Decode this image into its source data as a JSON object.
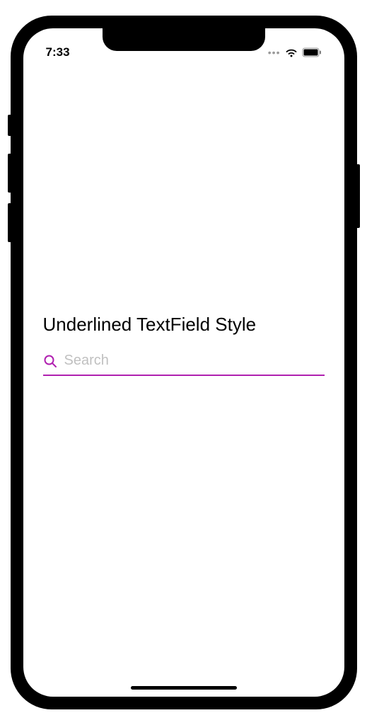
{
  "status_bar": {
    "time": "7:33"
  },
  "content": {
    "title": "Underlined TextField Style",
    "search": {
      "placeholder": "Search",
      "value": ""
    }
  },
  "colors": {
    "accent": "#b020b0"
  }
}
